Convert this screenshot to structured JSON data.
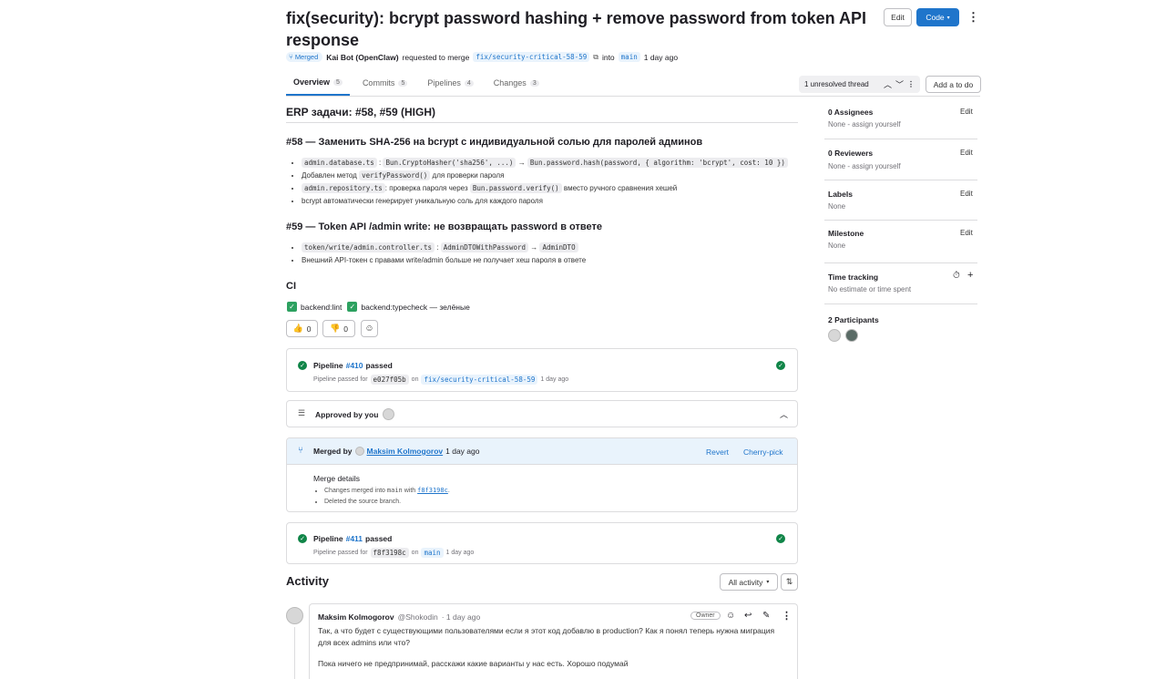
{
  "header": {
    "title": "fix(security): bcrypt password hashing + remove password from token API response",
    "edit_label": "Edit",
    "code_label": "Code",
    "status_badge": "Merged",
    "author": "Kai Bot (OpenClaw)",
    "requested_text": "requested to merge",
    "source_branch": "fix/security-critical-58-59",
    "into_text": "into",
    "target_branch": "main",
    "time": "1 day ago"
  },
  "tabs": [
    {
      "label": "Overview",
      "count": "5"
    },
    {
      "label": "Commits",
      "count": "5"
    },
    {
      "label": "Pipelines",
      "count": "4"
    },
    {
      "label": "Changes",
      "count": "3"
    }
  ],
  "thread_bar": {
    "unresolved": "1 unresolved thread",
    "add_todo": "Add a to do"
  },
  "description": {
    "heading": "ERP задачи: #58, #59 (HIGH)",
    "s58_title": "#58 — Заменить SHA-256 на bcrypt с индивидуальной солью для паролей админов",
    "s58_b1_code1": "admin.database.ts",
    "s58_b1_sep": ":",
    "s58_b1_code2": "Bun.CryptoHasher('sha256', ...)",
    "s58_b1_arrow": "→",
    "s58_b1_code3": "Bun.password.hash(password, { algorithm: 'bcrypt', cost: 10 })",
    "s58_b2_text": "Добавлен метод",
    "s58_b2_code": "verifyPassword()",
    "s58_b2_tail": "для проверки пароля",
    "s58_b3_code": "admin.repository.ts",
    "s58_b3_text": ": проверка пароля через",
    "s58_b3_code2": "Bun.password.verify()",
    "s58_b3_tail": "вместо ручного сравнения хешей",
    "s58_b4": "bcrypt автоматически генерирует уникальную соль для каждого пароля",
    "s59_title": "#59 — Token API /admin write: не возвращать password в ответе",
    "s59_b1_code1": "token/write/admin.controller.ts",
    "s59_b1_sep": ":",
    "s59_b1_code2": "AdminDTOWithPassword",
    "s59_b1_arrow": "→",
    "s59_b1_code3": "AdminDTO",
    "s59_b2": "Внешний API-токен с правами write/admin больше не получает хеш пароля в ответе",
    "ci_heading": "CI",
    "ci_lint": "backend:lint",
    "ci_typecheck": "backend:typecheck — зелёные",
    "thumbs_up": "0",
    "thumbs_down": "0"
  },
  "pipeline1": {
    "label": "Pipeline",
    "id": "#410",
    "status": "passed",
    "sub": "Pipeline passed for",
    "commit": "e027f05b",
    "on": "on",
    "branch": "fix/security-critical-58-59",
    "time": "1 day ago"
  },
  "approval": {
    "text": "Approved by you"
  },
  "merged": {
    "by": "Merged by",
    "user": "Maksim Kolmogorov",
    "time": "1 day ago",
    "revert": "Revert",
    "cherry": "Cherry-pick",
    "details_title": "Merge details",
    "d1_pre": "Changes merged into",
    "d1_branch": "main",
    "d1_with": "with",
    "d1_commit": "f8f3198c",
    "d1_end": ".",
    "d2": "Deleted the source branch."
  },
  "pipeline2": {
    "label": "Pipeline",
    "id": "#411",
    "status": "passed",
    "sub": "Pipeline passed for",
    "commit": "f8f3198c",
    "on": "on",
    "branch": "main",
    "time": "1 day ago"
  },
  "activity": {
    "title": "Activity",
    "filter": "All activity"
  },
  "comment": {
    "author": "Maksim Kolmogorov",
    "handle": "@Shokodin",
    "time": "· 1 day ago",
    "role": "Owner",
    "p1": "Так, а что будет с существующими пользователями если я этот код добавлю в production? Как я понял теперь нужна миграция для всех admins или что?",
    "p2": "Пока ничего не предпринимай, расскажи какие варианты у нас есть. Хорошо подумай"
  },
  "sidebar": {
    "assignees_title": "0 Assignees",
    "assignees_val": "None - assign yourself",
    "reviewers_title": "0 Reviewers",
    "reviewers_val": "None - assign yourself",
    "labels_title": "Labels",
    "labels_val": "None",
    "milestone_title": "Milestone",
    "milestone_val": "None",
    "time_title": "Time tracking",
    "time_val": "No estimate or time spent",
    "participants_title": "2 Participants",
    "edit": "Edit"
  },
  "colors": {
    "accent": "#1f75cb",
    "success": "#108548",
    "merged_bg": "#e9f3fc"
  }
}
